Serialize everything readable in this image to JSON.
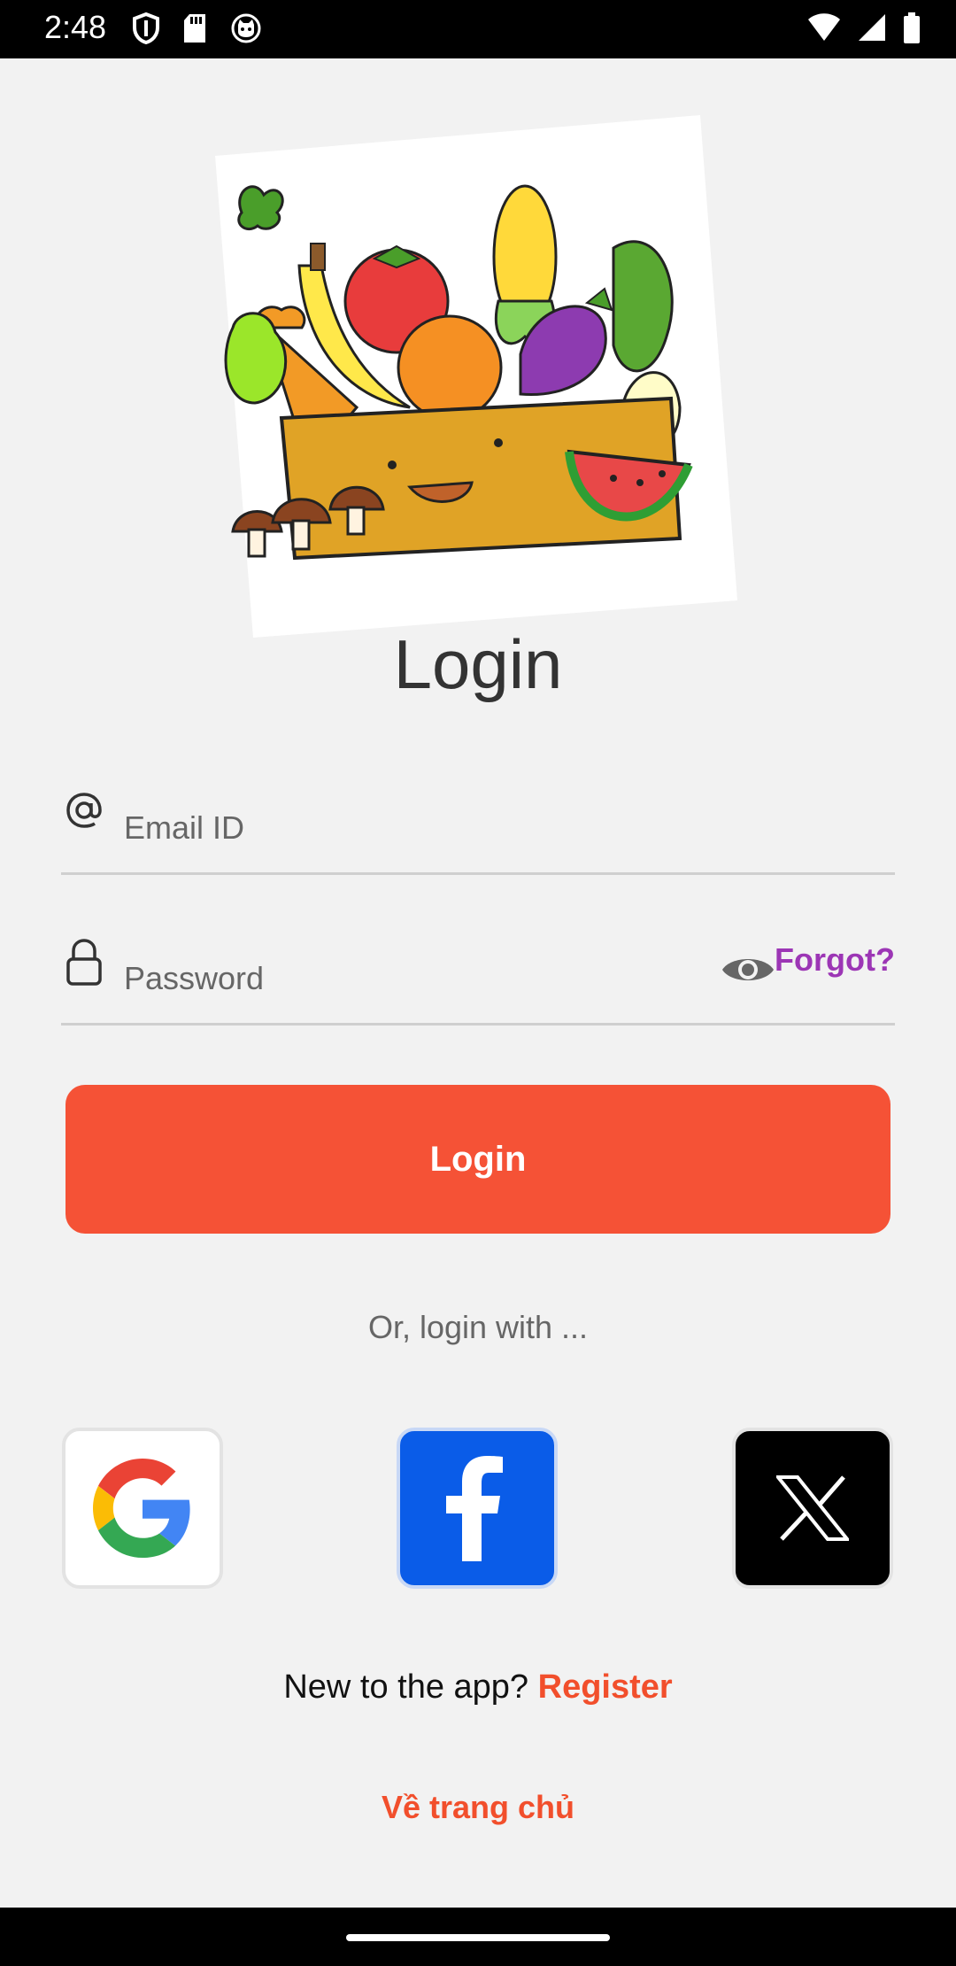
{
  "status_bar": {
    "time": "2:48"
  },
  "title": "Login",
  "email": {
    "placeholder": "Email ID",
    "value": ""
  },
  "password": {
    "placeholder": "Password",
    "value": ""
  },
  "forgot_label": "Forgot?",
  "login_button_label": "Login",
  "or_text": "Or, login with ...",
  "social_buttons": [
    {
      "name": "Google",
      "icon": "google-icon"
    },
    {
      "name": "Facebook",
      "icon": "facebook-icon"
    },
    {
      "name": "X",
      "icon": "x-icon"
    }
  ],
  "register": {
    "prompt": "New to the app?",
    "link_label": "Register"
  },
  "home_link_label": "Về trang chủ",
  "colors": {
    "accent": "#f55236",
    "forgot": "#9c36b5",
    "background": "#f2f2f2",
    "facebook": "#0a5ce8"
  }
}
